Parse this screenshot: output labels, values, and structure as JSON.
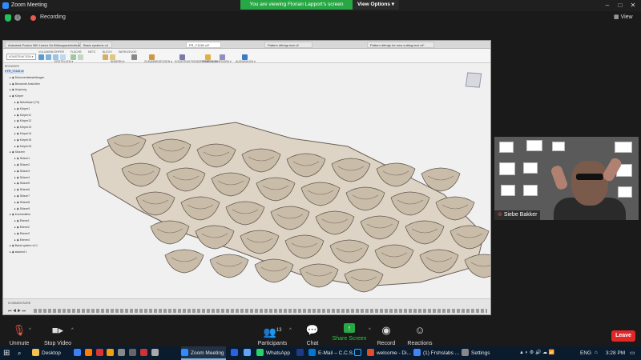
{
  "window": {
    "title": "Zoom Meeting"
  },
  "banner": {
    "text": "You are viewing Florian Lapport's screen",
    "view_options": "View Options ▾"
  },
  "top": {
    "recording": "Recording",
    "view": "View"
  },
  "fusion": {
    "tabs": [
      "Autodesk Fusion 360 Lizenz für Bildungseinrichtungen",
      "Basic systems v4",
      "FR_Y1118 v4*",
      "Pattern difmigr test v2",
      "Pattern difmigr for new cutting test v4*"
    ],
    "active_tab": "FR_Y1118 v4*",
    "menus": [
      "VOLUMENKÖRPER",
      "FLÄCHE",
      "NETZ",
      "BLECH",
      "WERKZEUGE"
    ],
    "toolbar_groups": [
      "KONSTRUKTION ▾",
      "ERSTELLEN ▾",
      "ÄNDERN ▾",
      "ZUSAMMENFÜGEN ▾",
      "KONSTRUKTIONSZEICHNUNG ▾",
      "PRÜFEN ▾",
      "EINFÜGEN ▾",
      "AUSWÄHLEN ▾"
    ],
    "browser_title": "BROWSER",
    "tree": [
      {
        "label": "FR_Y1118 v4",
        "indent": 0,
        "selected": true
      },
      {
        "label": "Dokumenteinstellungen",
        "indent": 1
      },
      {
        "label": "Benannte Ansichten",
        "indent": 1
      },
      {
        "label": "Ursprung",
        "indent": 1
      },
      {
        "label": "Körper",
        "indent": 1
      },
      {
        "label": "Netzkörper (73)",
        "indent": 2
      },
      {
        "label": "Körper1",
        "indent": 2
      },
      {
        "label": "Körper11",
        "indent": 2
      },
      {
        "label": "Körper12",
        "indent": 2
      },
      {
        "label": "Körper13",
        "indent": 2
      },
      {
        "label": "Körper14",
        "indent": 2
      },
      {
        "label": "Körper15",
        "indent": 2
      },
      {
        "label": "Körper16",
        "indent": 2
      },
      {
        "label": "Skizzen",
        "indent": 1
      },
      {
        "label": "Skizze1",
        "indent": 2
      },
      {
        "label": "Skizze2",
        "indent": 2
      },
      {
        "label": "Skizze3",
        "indent": 2
      },
      {
        "label": "Skizze4",
        "indent": 2
      },
      {
        "label": "Skizze5",
        "indent": 2
      },
      {
        "label": "Skizze6",
        "indent": 2
      },
      {
        "label": "Skizze7",
        "indent": 2
      },
      {
        "label": "Skizze8",
        "indent": 2
      },
      {
        "label": "Skizze9",
        "indent": 2
      },
      {
        "label": "Konstruktion",
        "indent": 1
      },
      {
        "label": "Ebene1",
        "indent": 2
      },
      {
        "label": "Ebene2",
        "indent": 2
      },
      {
        "label": "Ebene3",
        "indent": 2
      },
      {
        "label": "Ebene4",
        "indent": 2
      },
      {
        "label": "Basis system v4:1",
        "indent": 1
      },
      {
        "label": "stacked 1",
        "indent": 1
      }
    ],
    "comments": "KOMMENTARE"
  },
  "video": {
    "name": "Siebe Bakker"
  },
  "controls": {
    "unmute": "Unmute",
    "stop_video": "Stop Video",
    "participants": "Participants",
    "participants_count": "13",
    "chat": "Chat",
    "share_screen": "Share Screen",
    "record": "Record",
    "reactions": "Reactions",
    "leave": "Leave"
  },
  "taskbar": {
    "items": [
      "Desktop",
      "Zoom Meeting",
      "WhatsApp",
      "E-Mail – C.C.S...",
      "welcome - Di...",
      "(1) Frshslabs ...",
      "Settings"
    ],
    "lang": "ENG",
    "time": "3:28 PM"
  },
  "colors": {
    "share_green": "#28a745",
    "leave_red": "#e02828",
    "taskbar": "#0b1b2e"
  }
}
